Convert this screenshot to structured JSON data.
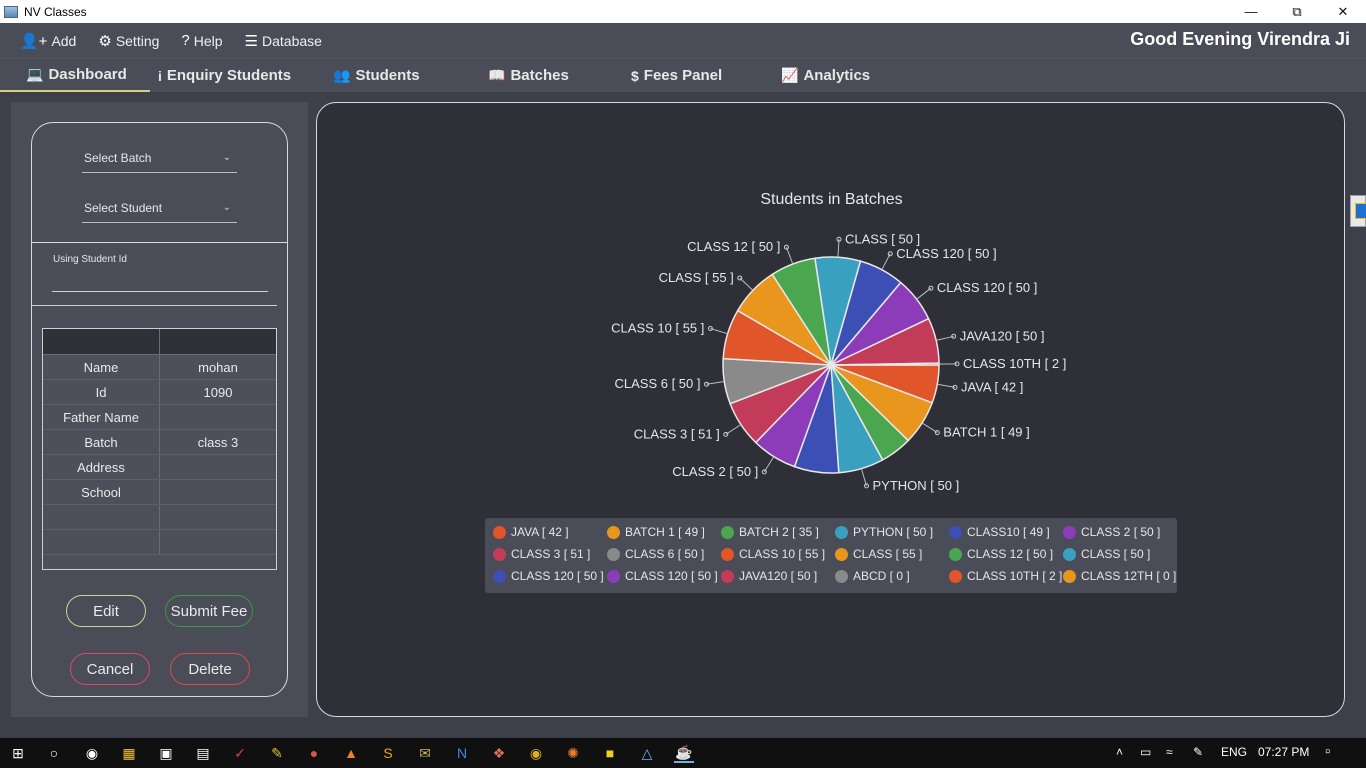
{
  "window": {
    "title": "NV Classes"
  },
  "menubar": {
    "items": [
      {
        "label": "Add",
        "icon": "add-user-icon"
      },
      {
        "label": "Setting",
        "icon": "gear-icon"
      },
      {
        "label": "Help",
        "icon": "question-icon"
      },
      {
        "label": "Database",
        "icon": "database-icon"
      }
    ],
    "greeting": "Good Evening Virendra Ji"
  },
  "tabs": [
    {
      "label": "Dashboard",
      "icon": "laptop-icon",
      "active": true
    },
    {
      "label": "Enquiry Students",
      "icon": "info-icon"
    },
    {
      "label": "Students",
      "icon": "users-icon"
    },
    {
      "label": "Batches",
      "icon": "book-icon"
    },
    {
      "label": "Fees Panel",
      "icon": "dollar-icon"
    },
    {
      "label": "Analytics",
      "icon": "chart-icon"
    }
  ],
  "left": {
    "select_batch": "Select Batch",
    "select_student": "Select Student",
    "student_id_label": "Using Student Id",
    "student_id_value": "",
    "rows": [
      {
        "label": "Name",
        "value": "mohan"
      },
      {
        "label": "Id",
        "value": "1090"
      },
      {
        "label": "Father Name",
        "value": ""
      },
      {
        "label": "Batch",
        "value": "class 3"
      },
      {
        "label": "Address",
        "value": ""
      },
      {
        "label": "School",
        "value": ""
      },
      {
        "label": "",
        "value": ""
      },
      {
        "label": "",
        "value": ""
      }
    ],
    "buttons": {
      "edit": "Edit",
      "submit": "Submit Fee",
      "cancel": "Cancel",
      "delete": "Delete"
    }
  },
  "chart_data": {
    "type": "pie",
    "title": "Students in Batches",
    "slices": [
      {
        "label": "JAVA [ 42 ]",
        "value": 42,
        "color": "#e0552a"
      },
      {
        "label": "BATCH 1 [ 49 ]",
        "value": 49,
        "color": "#e8961e"
      },
      {
        "label": "BATCH 2 [ 35 ]",
        "value": 35,
        "color": "#4aa64f"
      },
      {
        "label": "PYTHON [ 50 ]",
        "value": 50,
        "color": "#3aa0c0"
      },
      {
        "label": "CLASS10 [ 49 ]",
        "value": 49,
        "color": "#3c4fb5"
      },
      {
        "label": "CLASS 2 [ 50 ]",
        "value": 50,
        "color": "#8c3cb8"
      },
      {
        "label": "CLASS 3 [ 51 ]",
        "value": 51,
        "color": "#c23c5a"
      },
      {
        "label": "CLASS 6 [ 50 ]",
        "value": 50,
        "color": "#8a8a8a"
      },
      {
        "label": "CLASS 10 [ 55 ]",
        "value": 55,
        "color": "#e0552a"
      },
      {
        "label": "CLASS [ 55 ]",
        "value": 55,
        "color": "#e8961e"
      },
      {
        "label": "CLASS 12 [ 50 ]",
        "value": 50,
        "color": "#4aa64f"
      },
      {
        "label": "CLASS  [ 50 ]",
        "value": 50,
        "color": "#3aa0c0"
      },
      {
        "label": "CLASS 120 [ 50 ]",
        "value": 50,
        "color": "#3c4fb5"
      },
      {
        "label": "CLASS 120 [ 50 ]",
        "value": 50,
        "color": "#8c3cb8"
      },
      {
        "label": "JAVA120 [ 50 ]",
        "value": 50,
        "color": "#c23c5a"
      },
      {
        "label": "ABCD [ 0 ]",
        "value": 0,
        "color": "#8a8a8a"
      },
      {
        "label": "CLASS 10TH [ 2 ]",
        "value": 2,
        "color": "#e0552a"
      },
      {
        "label": "CLASS 12TH [ 0 ]",
        "value": 0,
        "color": "#e8961e"
      }
    ],
    "callout_labels": [
      "CLASS  [ 50 ]",
      "CLASS 120 [ 50 ]",
      "JAVA120 [ 50 ]",
      "CLASS 10TH [ 2 ]",
      "JAVA [ 42 ]",
      "BATCH 1 [ 49 ]",
      "PYTHON [ 50 ]",
      "CLASS 2 [ 50 ]",
      "CLASS 3 [ 51 ]",
      "CLASS 6 [ 50 ]",
      "CLASS 10 [ 55 ]",
      "CLASS [ 55 ]",
      "CLASS 12 [ 50 ]"
    ],
    "legend": "bottom"
  },
  "taskbar": {
    "language": "ENG",
    "time": "07:27 PM"
  }
}
